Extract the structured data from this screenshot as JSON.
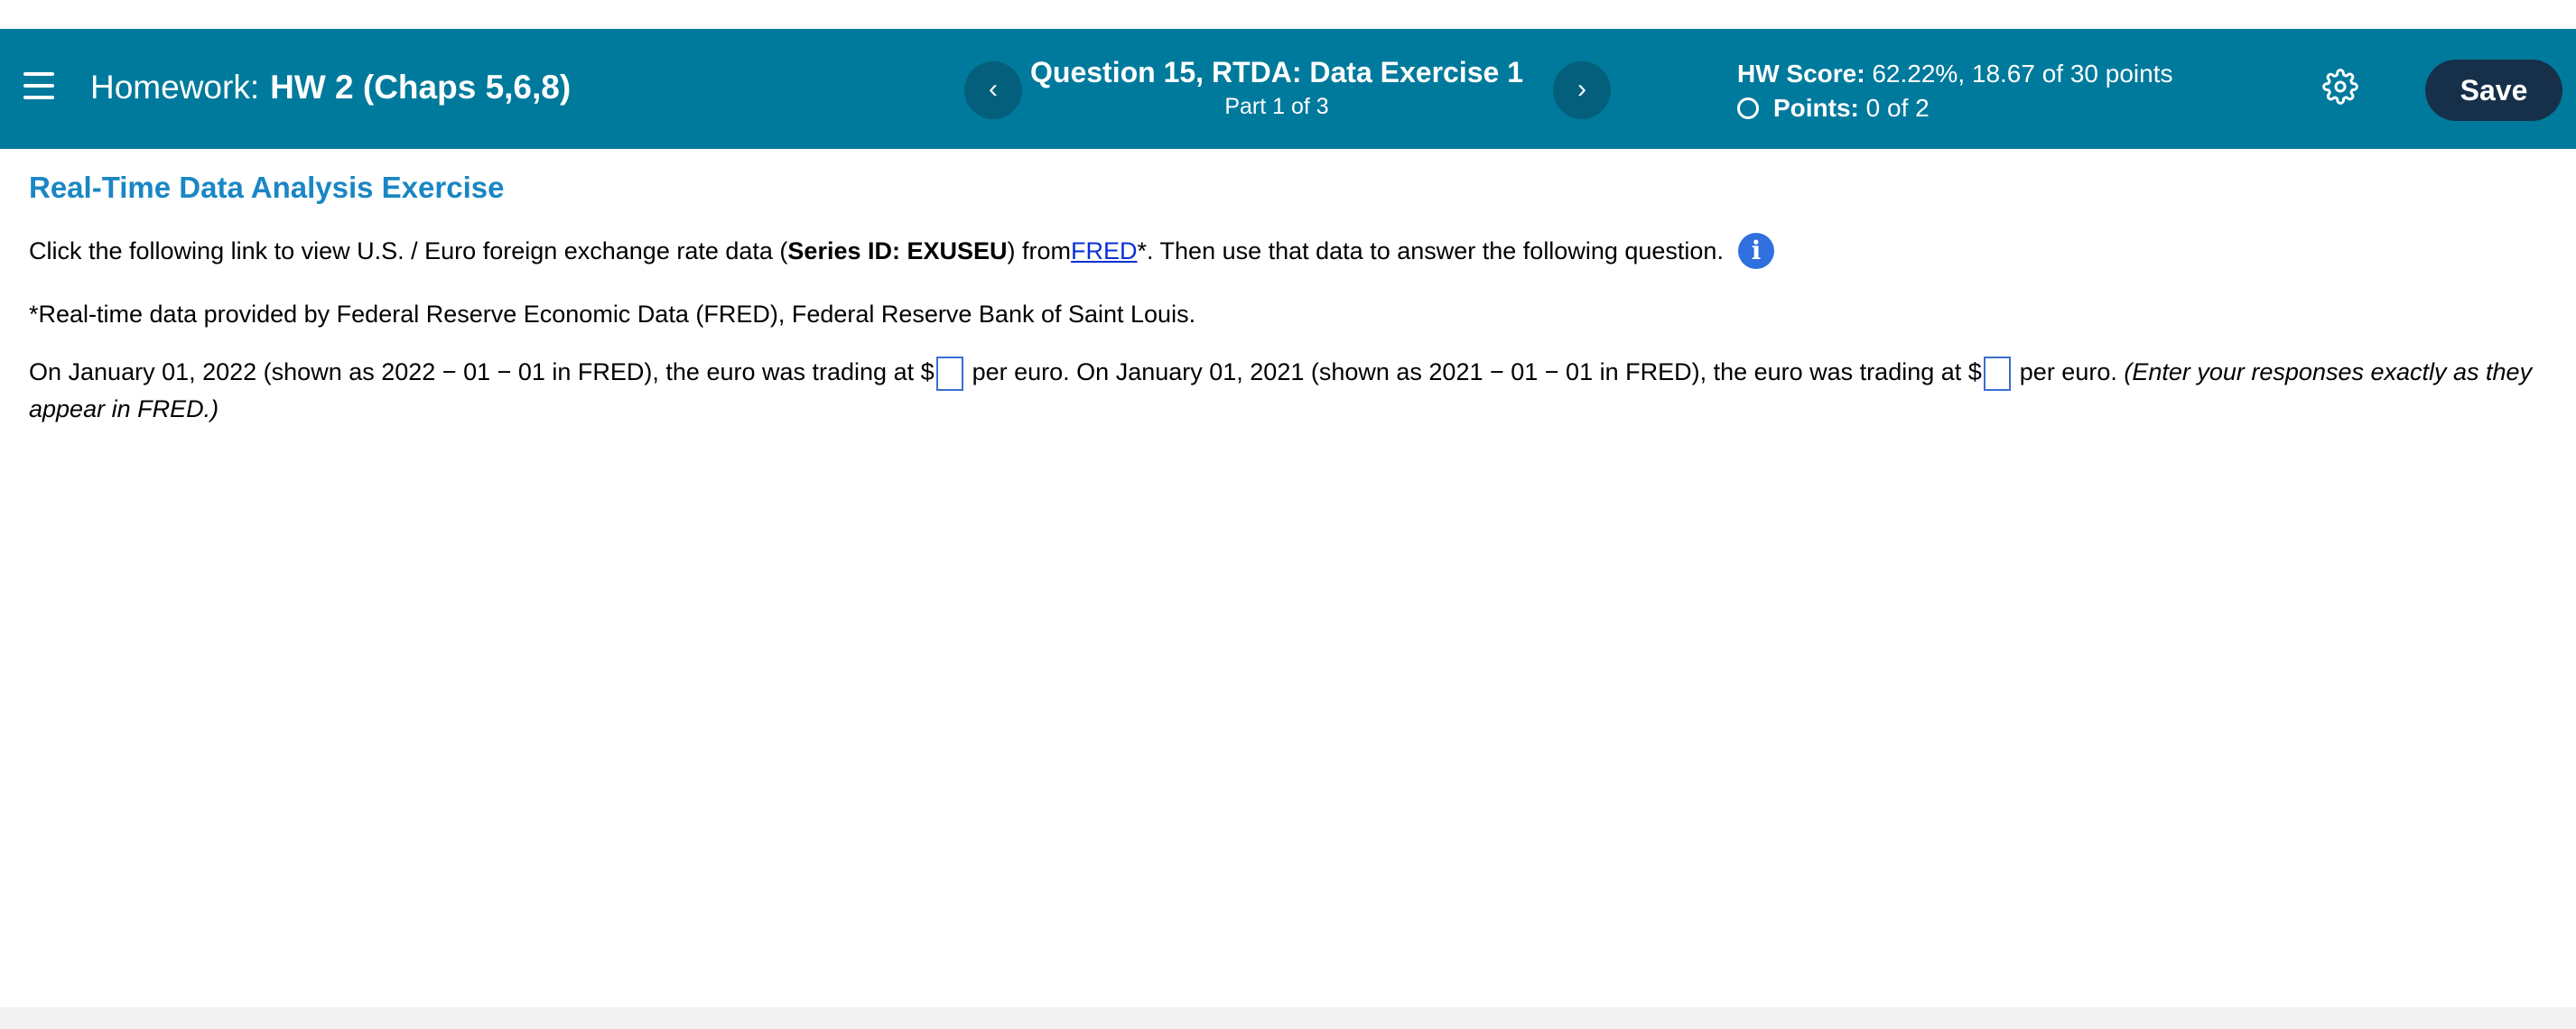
{
  "header": {
    "homework_label": "Homework:",
    "homework_name": "HW 2 (Chaps 5,6,8)",
    "question_title": "Question 15, RTDA: Data Exercise 1",
    "question_part": "Part 1 of 3",
    "prev_label": "‹",
    "next_label": "›",
    "score_label": "HW Score:",
    "score_value": "62.22%, 18.67 of 30 points",
    "points_label": "Points:",
    "points_value": "0 of 2",
    "save_label": "Save"
  },
  "content": {
    "section_title": "Real-Time Data Analysis Exercise",
    "p1_before": "Click the following link to view U.S.  /  Euro foreign exchange rate data (",
    "p1_series": "Series ID: EXUSEU",
    "p1_from": ") from ",
    "p1_link": "FRED",
    "p1_after": "*.  Then use that data to answer the following question.",
    "info_glyph": "i",
    "p2": "*Real-time data provided by Federal Reserve Economic Data (FRED), Federal Reserve Bank of Saint Louis.",
    "p3_part1": "On January 01, 2022 (shown as 2022 − 01 − 01 in FRED), the euro was trading at $",
    "p3_part2": "per euro. On January 01, 2021 (shown as 2021 − 01 − 01 in FRED), the euro was trading at $",
    "p3_part3": "per euro. ",
    "p3_note": "(Enter your responses exactly as they appear in FRED.)"
  },
  "colors": {
    "header_bg": "#007a9c",
    "nav_btn_bg": "#035f7b",
    "save_btn_bg": "#16304a",
    "section_title": "#1a86c4",
    "link": "#0a2fd6",
    "info_icon": "#2f6fde"
  }
}
